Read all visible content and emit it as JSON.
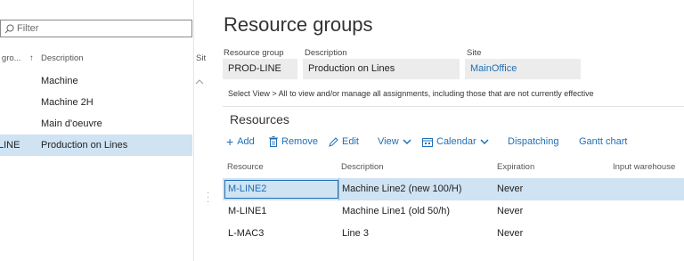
{
  "filter": {
    "placeholder": "Filter"
  },
  "list": {
    "headers": {
      "group": "e gro...",
      "sort": "↑",
      "description": "Description",
      "site": "Sit"
    },
    "rows": [
      {
        "group": "",
        "description": "Machine"
      },
      {
        "group": "",
        "description": "Machine 2H"
      },
      {
        "group": "",
        "description": "Main d'oeuvre"
      },
      {
        "group": "LINE",
        "description": "Production on Lines"
      }
    ],
    "selected_index": 3
  },
  "detail": {
    "title": "Resource groups",
    "fields": {
      "resource_group_label": "Resource group",
      "resource_group_value": "PROD-LINE",
      "description_label": "Description",
      "description_value": "Production on Lines",
      "site_label": "Site",
      "site_value": "MainOffice"
    },
    "info": "Select View > All to view and/or manage all assignments, including those that are not currently effective",
    "resources_title": "Resources",
    "toolbar": {
      "add": "Add",
      "remove": "Remove",
      "edit": "Edit",
      "view": "View",
      "calendar": "Calendar",
      "dispatching": "Dispatching",
      "gantt": "Gantt chart"
    },
    "grid": {
      "headers": {
        "resource": "Resource",
        "description": "Description",
        "expiration": "Expiration",
        "input_warehouse": "Input warehouse"
      },
      "rows": [
        {
          "resource": "M-LINE2",
          "description": "Machine Line2 (new 100/H)",
          "expiration": "Never"
        },
        {
          "resource": "M-LINE1",
          "description": "Machine Line1 (old 50/h)",
          "expiration": "Never"
        },
        {
          "resource": "L-MAC3",
          "description": "Line 3",
          "expiration": "Never"
        }
      ]
    }
  },
  "colors": {
    "accent": "#1f6fb5",
    "selection": "#cfe3f3",
    "field_bg": "#ececec"
  }
}
